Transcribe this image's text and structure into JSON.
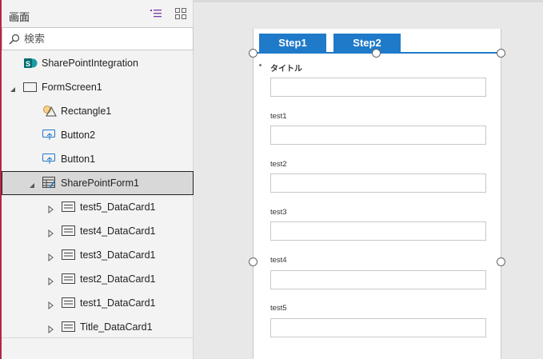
{
  "tree": {
    "title": "画面",
    "search_placeholder": "検索",
    "items": [
      {
        "label": "SharePointIntegration",
        "icon": "sharepoint-icon"
      },
      {
        "label": "FormScreen1",
        "icon": "screen-icon",
        "expanded": true
      },
      {
        "label": "Rectangle1",
        "icon": "shapes-icon"
      },
      {
        "label": "Button2",
        "icon": "button-icon"
      },
      {
        "label": "Button1",
        "icon": "button-icon"
      },
      {
        "label": "SharePointForm1",
        "icon": "form-icon",
        "expanded": true,
        "selected": true
      },
      {
        "label": "test5_DataCard1",
        "icon": "datacard-icon",
        "expanded": false
      },
      {
        "label": "test4_DataCard1",
        "icon": "datacard-icon",
        "expanded": false
      },
      {
        "label": "test3_DataCard1",
        "icon": "datacard-icon",
        "expanded": false
      },
      {
        "label": "test2_DataCard1",
        "icon": "datacard-icon",
        "expanded": false
      },
      {
        "label": "test1_DataCard1",
        "icon": "datacard-icon",
        "expanded": false
      },
      {
        "label": "Title_DataCard1",
        "icon": "datacard-icon",
        "expanded": false
      }
    ]
  },
  "canvas": {
    "step1_label": "Step1",
    "step2_label": "Step2",
    "title_field_label": "タイトル",
    "fields": [
      "test1",
      "test2",
      "test3",
      "test4",
      "test5"
    ]
  },
  "colors": {
    "accent": "#1f7ac9",
    "left_stripe": "#b4254a",
    "selected_row": "#d8d8d8"
  }
}
